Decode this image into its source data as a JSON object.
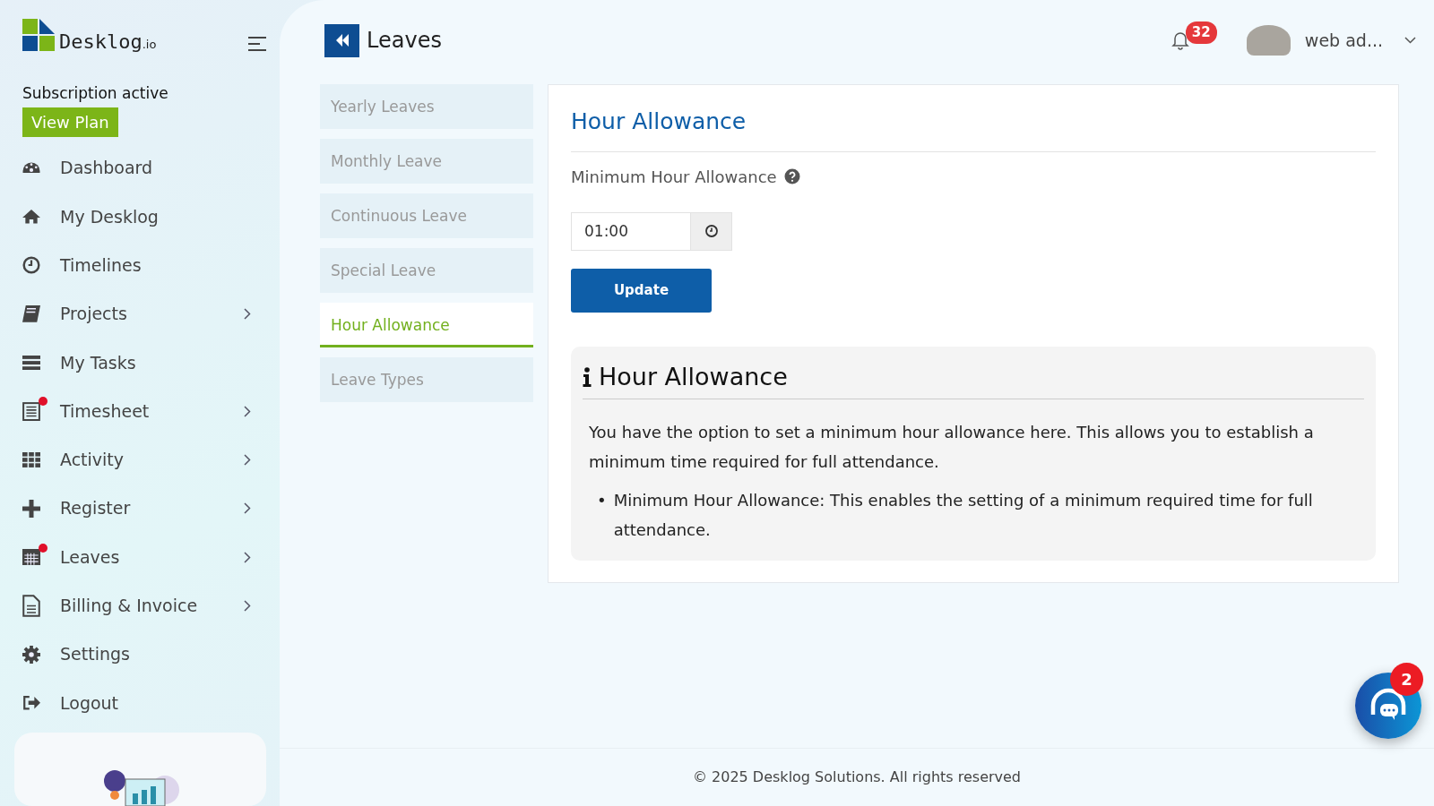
{
  "brand": {
    "name": "Desklog",
    "suffix": ".io"
  },
  "subscription": {
    "status": "Subscription active",
    "button": "View Plan"
  },
  "sidebar": {
    "items": [
      {
        "label": "Dashboard",
        "submenu": false,
        "dot": false
      },
      {
        "label": "My Desklog",
        "submenu": false,
        "dot": false
      },
      {
        "label": "Timelines",
        "submenu": false,
        "dot": false
      },
      {
        "label": "Projects",
        "submenu": true,
        "dot": false
      },
      {
        "label": "My Tasks",
        "submenu": false,
        "dot": false
      },
      {
        "label": "Timesheet",
        "submenu": true,
        "dot": true
      },
      {
        "label": "Activity",
        "submenu": true,
        "dot": false
      },
      {
        "label": "Register",
        "submenu": true,
        "dot": false
      },
      {
        "label": "Leaves",
        "submenu": true,
        "dot": true
      },
      {
        "label": "Billing & Invoice",
        "submenu": true,
        "dot": false
      },
      {
        "label": "Settings",
        "submenu": false,
        "dot": false
      },
      {
        "label": "Logout",
        "submenu": false,
        "dot": false
      }
    ]
  },
  "header": {
    "title": "Leaves",
    "notifications": "32",
    "user": "web ad..."
  },
  "tabs": [
    {
      "label": "Yearly Leaves",
      "selected": false
    },
    {
      "label": "Monthly Leave",
      "selected": false
    },
    {
      "label": "Continuous Leave",
      "selected": false
    },
    {
      "label": "Special Leave",
      "selected": false
    },
    {
      "label": "Hour Allowance",
      "selected": true
    },
    {
      "label": "Leave Types",
      "selected": false
    }
  ],
  "panel": {
    "title": "Hour Allowance",
    "field_label": "Minimum Hour Allowance",
    "value": "01:00",
    "button": "Update",
    "info": {
      "title": "Hour Allowance",
      "text": "You have the option to set a minimum hour allowance here. This allows you to establish a minimum time required for full attendance.",
      "bullets": [
        {
          "marker": "•",
          "text": "Minimum Hour Allowance: This enables the setting of a minimum required time for full attendance."
        }
      ]
    }
  },
  "chat": {
    "badge": "2"
  },
  "footer": "© 2025 Desklog Solutions. All rights reserved"
}
